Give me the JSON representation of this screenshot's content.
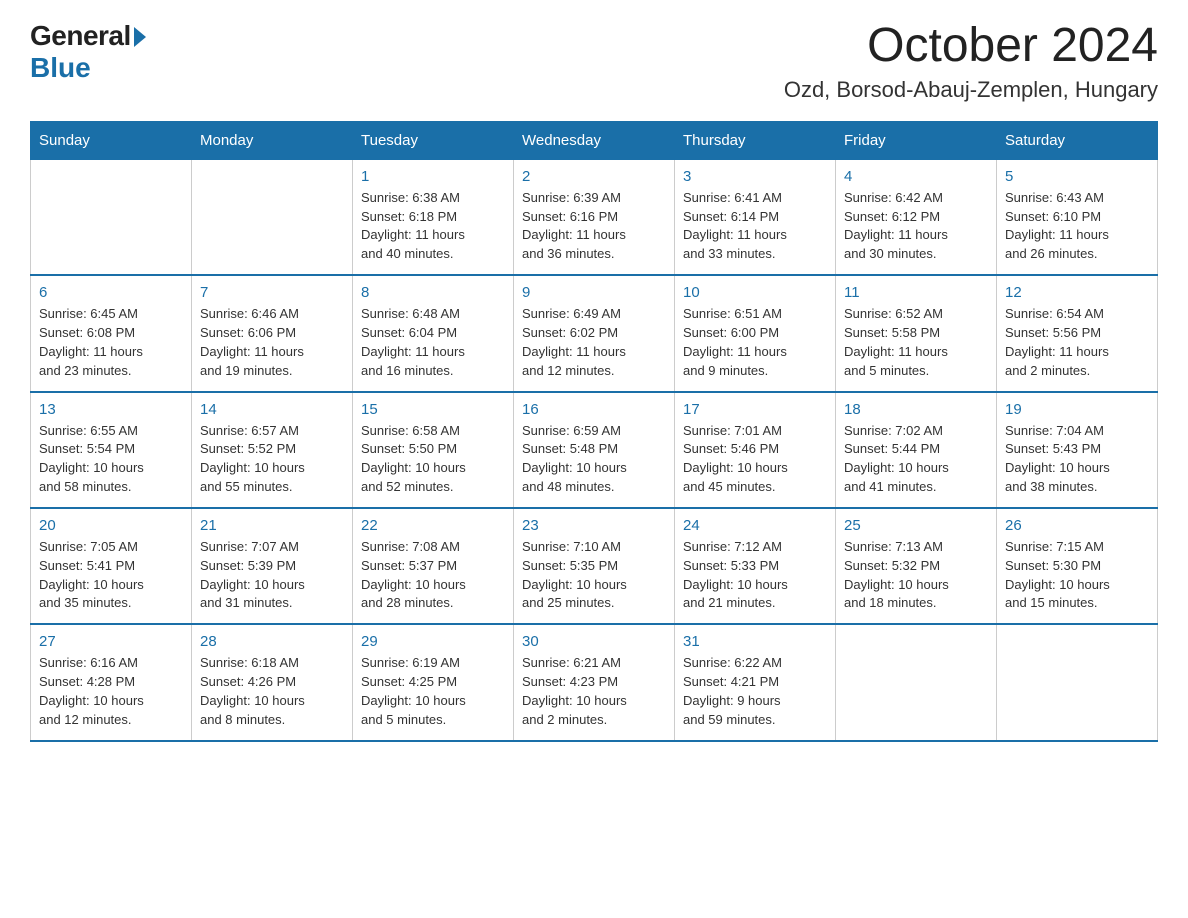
{
  "header": {
    "logo_general": "General",
    "logo_blue": "Blue",
    "month_title": "October 2024",
    "location": "Ozd, Borsod-Abauj-Zemplen, Hungary"
  },
  "weekdays": [
    "Sunday",
    "Monday",
    "Tuesday",
    "Wednesday",
    "Thursday",
    "Friday",
    "Saturday"
  ],
  "weeks": [
    [
      {
        "day": "",
        "info": ""
      },
      {
        "day": "",
        "info": ""
      },
      {
        "day": "1",
        "info": "Sunrise: 6:38 AM\nSunset: 6:18 PM\nDaylight: 11 hours\nand 40 minutes."
      },
      {
        "day": "2",
        "info": "Sunrise: 6:39 AM\nSunset: 6:16 PM\nDaylight: 11 hours\nand 36 minutes."
      },
      {
        "day": "3",
        "info": "Sunrise: 6:41 AM\nSunset: 6:14 PM\nDaylight: 11 hours\nand 33 minutes."
      },
      {
        "day": "4",
        "info": "Sunrise: 6:42 AM\nSunset: 6:12 PM\nDaylight: 11 hours\nand 30 minutes."
      },
      {
        "day": "5",
        "info": "Sunrise: 6:43 AM\nSunset: 6:10 PM\nDaylight: 11 hours\nand 26 minutes."
      }
    ],
    [
      {
        "day": "6",
        "info": "Sunrise: 6:45 AM\nSunset: 6:08 PM\nDaylight: 11 hours\nand 23 minutes."
      },
      {
        "day": "7",
        "info": "Sunrise: 6:46 AM\nSunset: 6:06 PM\nDaylight: 11 hours\nand 19 minutes."
      },
      {
        "day": "8",
        "info": "Sunrise: 6:48 AM\nSunset: 6:04 PM\nDaylight: 11 hours\nand 16 minutes."
      },
      {
        "day": "9",
        "info": "Sunrise: 6:49 AM\nSunset: 6:02 PM\nDaylight: 11 hours\nand 12 minutes."
      },
      {
        "day": "10",
        "info": "Sunrise: 6:51 AM\nSunset: 6:00 PM\nDaylight: 11 hours\nand 9 minutes."
      },
      {
        "day": "11",
        "info": "Sunrise: 6:52 AM\nSunset: 5:58 PM\nDaylight: 11 hours\nand 5 minutes."
      },
      {
        "day": "12",
        "info": "Sunrise: 6:54 AM\nSunset: 5:56 PM\nDaylight: 11 hours\nand 2 minutes."
      }
    ],
    [
      {
        "day": "13",
        "info": "Sunrise: 6:55 AM\nSunset: 5:54 PM\nDaylight: 10 hours\nand 58 minutes."
      },
      {
        "day": "14",
        "info": "Sunrise: 6:57 AM\nSunset: 5:52 PM\nDaylight: 10 hours\nand 55 minutes."
      },
      {
        "day": "15",
        "info": "Sunrise: 6:58 AM\nSunset: 5:50 PM\nDaylight: 10 hours\nand 52 minutes."
      },
      {
        "day": "16",
        "info": "Sunrise: 6:59 AM\nSunset: 5:48 PM\nDaylight: 10 hours\nand 48 minutes."
      },
      {
        "day": "17",
        "info": "Sunrise: 7:01 AM\nSunset: 5:46 PM\nDaylight: 10 hours\nand 45 minutes."
      },
      {
        "day": "18",
        "info": "Sunrise: 7:02 AM\nSunset: 5:44 PM\nDaylight: 10 hours\nand 41 minutes."
      },
      {
        "day": "19",
        "info": "Sunrise: 7:04 AM\nSunset: 5:43 PM\nDaylight: 10 hours\nand 38 minutes."
      }
    ],
    [
      {
        "day": "20",
        "info": "Sunrise: 7:05 AM\nSunset: 5:41 PM\nDaylight: 10 hours\nand 35 minutes."
      },
      {
        "day": "21",
        "info": "Sunrise: 7:07 AM\nSunset: 5:39 PM\nDaylight: 10 hours\nand 31 minutes."
      },
      {
        "day": "22",
        "info": "Sunrise: 7:08 AM\nSunset: 5:37 PM\nDaylight: 10 hours\nand 28 minutes."
      },
      {
        "day": "23",
        "info": "Sunrise: 7:10 AM\nSunset: 5:35 PM\nDaylight: 10 hours\nand 25 minutes."
      },
      {
        "day": "24",
        "info": "Sunrise: 7:12 AM\nSunset: 5:33 PM\nDaylight: 10 hours\nand 21 minutes."
      },
      {
        "day": "25",
        "info": "Sunrise: 7:13 AM\nSunset: 5:32 PM\nDaylight: 10 hours\nand 18 minutes."
      },
      {
        "day": "26",
        "info": "Sunrise: 7:15 AM\nSunset: 5:30 PM\nDaylight: 10 hours\nand 15 minutes."
      }
    ],
    [
      {
        "day": "27",
        "info": "Sunrise: 6:16 AM\nSunset: 4:28 PM\nDaylight: 10 hours\nand 12 minutes."
      },
      {
        "day": "28",
        "info": "Sunrise: 6:18 AM\nSunset: 4:26 PM\nDaylight: 10 hours\nand 8 minutes."
      },
      {
        "day": "29",
        "info": "Sunrise: 6:19 AM\nSunset: 4:25 PM\nDaylight: 10 hours\nand 5 minutes."
      },
      {
        "day": "30",
        "info": "Sunrise: 6:21 AM\nSunset: 4:23 PM\nDaylight: 10 hours\nand 2 minutes."
      },
      {
        "day": "31",
        "info": "Sunrise: 6:22 AM\nSunset: 4:21 PM\nDaylight: 9 hours\nand 59 minutes."
      },
      {
        "day": "",
        "info": ""
      },
      {
        "day": "",
        "info": ""
      }
    ]
  ]
}
